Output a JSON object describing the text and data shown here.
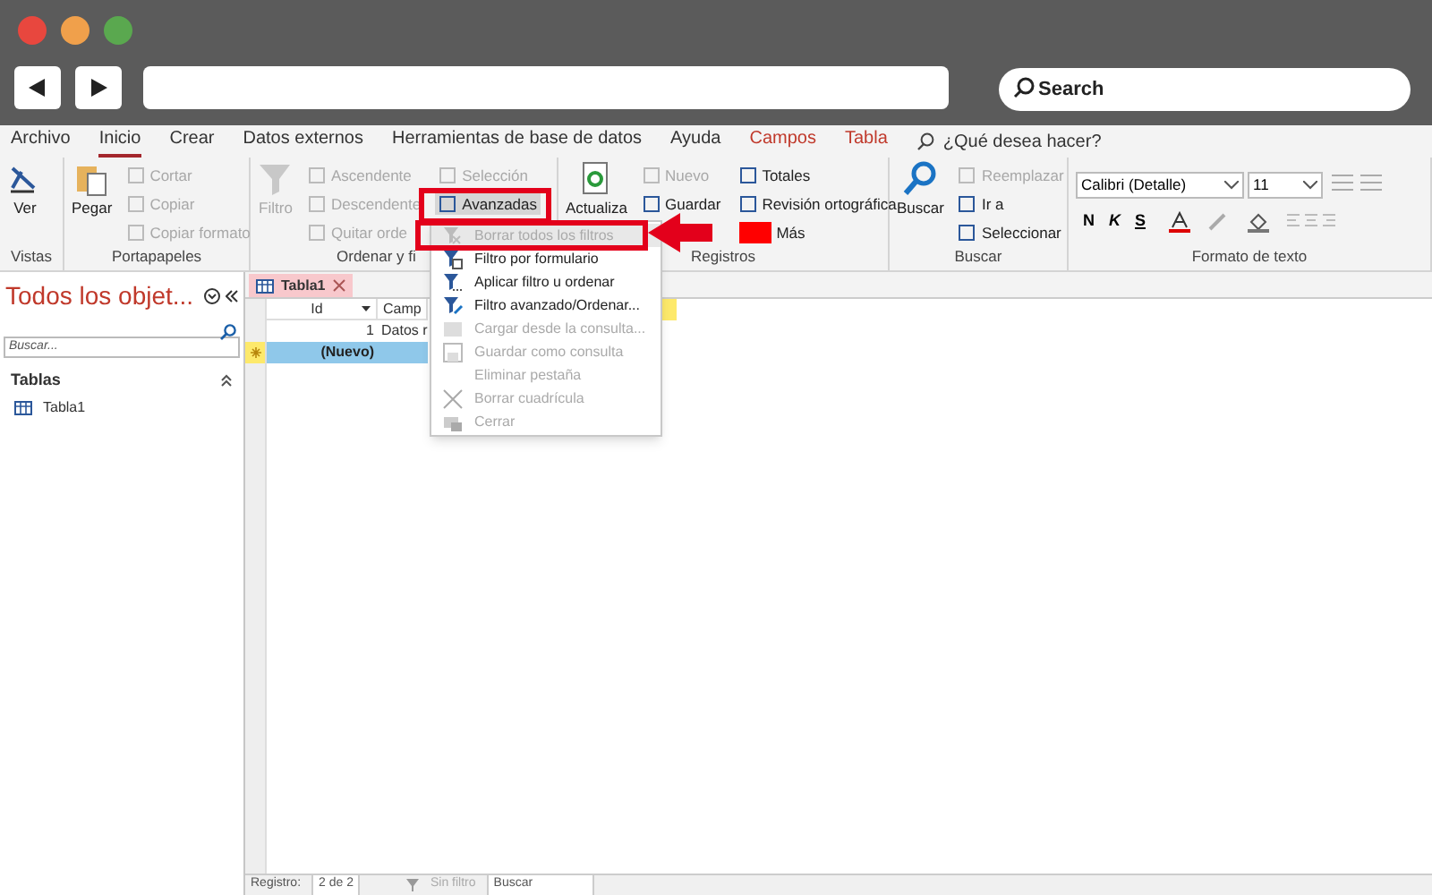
{
  "browser": {
    "search_placeholder": "Search"
  },
  "ribbon_tabs": [
    {
      "label": "Archivo",
      "selected": false,
      "kind": "standard"
    },
    {
      "label": "Inicio",
      "selected": true,
      "kind": "standard"
    },
    {
      "label": "Crear",
      "selected": false,
      "kind": "standard"
    },
    {
      "label": "Datos externos",
      "selected": false,
      "kind": "standard"
    },
    {
      "label": "Herramientas de base de datos",
      "selected": false,
      "kind": "standard"
    },
    {
      "label": "Ayuda",
      "selected": false,
      "kind": "standard"
    },
    {
      "label": "Campos",
      "selected": false,
      "kind": "contextual"
    },
    {
      "label": "Tabla",
      "selected": false,
      "kind": "contextual"
    }
  ],
  "tell_me": "¿Qué desea hacer?",
  "groups": [
    {
      "label": "Vistas",
      "columns": [
        [
          {
            "label": "Ver",
            "kind": "large",
            "disabled": false
          }
        ]
      ]
    },
    {
      "label": "Portapapeles",
      "columns": [
        [
          {
            "label": "Pegar",
            "kind": "large",
            "disabled": false
          }
        ],
        [
          {
            "label": "Cortar",
            "kind": "small",
            "disabled": true
          },
          {
            "label": "Copiar",
            "kind": "small",
            "disabled": true
          },
          {
            "label": "Copiar formato",
            "kind": "small",
            "disabled": true
          }
        ]
      ]
    },
    {
      "label": "Ordenar y fi",
      "columns": [
        [
          {
            "label": "Filtro",
            "kind": "large",
            "disabled": true
          }
        ],
        [
          {
            "label": "Ascendente",
            "kind": "small",
            "disabled": true
          },
          {
            "label": "Descendente",
            "kind": "small",
            "disabled": true
          },
          {
            "label": "Quitar orde",
            "kind": "small",
            "disabled": true
          }
        ],
        [
          {
            "label": "Selección",
            "kind": "small",
            "disabled": true
          },
          {
            "label": "Avanzadas",
            "kind": "small",
            "disabled": false,
            "pressed": true
          }
        ]
      ]
    },
    {
      "label": "Registros",
      "columns": [
        [
          {
            "label": "Actualiza",
            "kind": "large",
            "disabled": false
          }
        ],
        [
          {
            "label": "Nuevo",
            "kind": "small",
            "disabled": true
          },
          {
            "label": "Guardar",
            "kind": "small",
            "disabled": false
          }
        ],
        [
          {
            "label": "Totales",
            "kind": "small",
            "disabled": false
          },
          {
            "label": "Revisión ortográfica",
            "kind": "small",
            "disabled": false
          },
          {
            "label": "Más",
            "kind": "small",
            "disabled": false,
            "redacted": true
          }
        ]
      ]
    },
    {
      "label": "Buscar",
      "columns": [
        [
          {
            "label": "Buscar",
            "kind": "large",
            "disabled": false
          }
        ],
        [
          {
            "label": "Reemplazar",
            "kind": "small",
            "disabled": true
          },
          {
            "label": "Ir a",
            "kind": "small",
            "disabled": false
          },
          {
            "label": "Seleccionar",
            "kind": "small",
            "disabled": false
          }
        ]
      ]
    },
    {
      "label": "Formato de texto",
      "kind": "font",
      "font": "Calibri (Detalle)",
      "font_size": "11",
      "styles": [
        "N",
        "K",
        "S"
      ]
    }
  ],
  "nav": {
    "title": "Todos los objet...",
    "search_placeholder": "Buscar...",
    "section": "Tablas",
    "items": [
      {
        "label": "Tabla1"
      }
    ]
  },
  "document_tab": {
    "label": "Tabla1"
  },
  "datasheet": {
    "columns": [
      "Id",
      "Camp"
    ],
    "rows": [
      {
        "cells": [
          "1",
          "Datos r"
        ],
        "selected": false,
        "new": false
      },
      {
        "cells": [
          "(Nuevo)",
          ""
        ],
        "selected": true,
        "new": true
      }
    ]
  },
  "menu": {
    "items": [
      {
        "label": "Borrar todos los filtros",
        "disabled": true,
        "highlighted": true
      },
      {
        "label": "Filtro por formulario",
        "disabled": false,
        "highlighted": false
      },
      {
        "label": "Aplicar filtro u ordenar",
        "disabled": false,
        "highlighted": false
      },
      {
        "label": "Filtro avanzado/Ordenar...",
        "disabled": false,
        "highlighted": false
      },
      {
        "label": "Cargar desde la consulta...",
        "disabled": true,
        "highlighted": false
      },
      {
        "label": "Guardar como consulta",
        "disabled": true,
        "highlighted": false
      },
      {
        "label": "Eliminar pestaña",
        "disabled": true,
        "highlighted": false
      },
      {
        "label": "Borrar cuadrícula",
        "disabled": true,
        "highlighted": false
      },
      {
        "label": "Cerrar",
        "disabled": true,
        "highlighted": false
      }
    ]
  },
  "status_bar": {
    "record_label": "Registro:",
    "record_value": "2 de 2",
    "filter": "Sin filtro",
    "search": "Buscar"
  }
}
